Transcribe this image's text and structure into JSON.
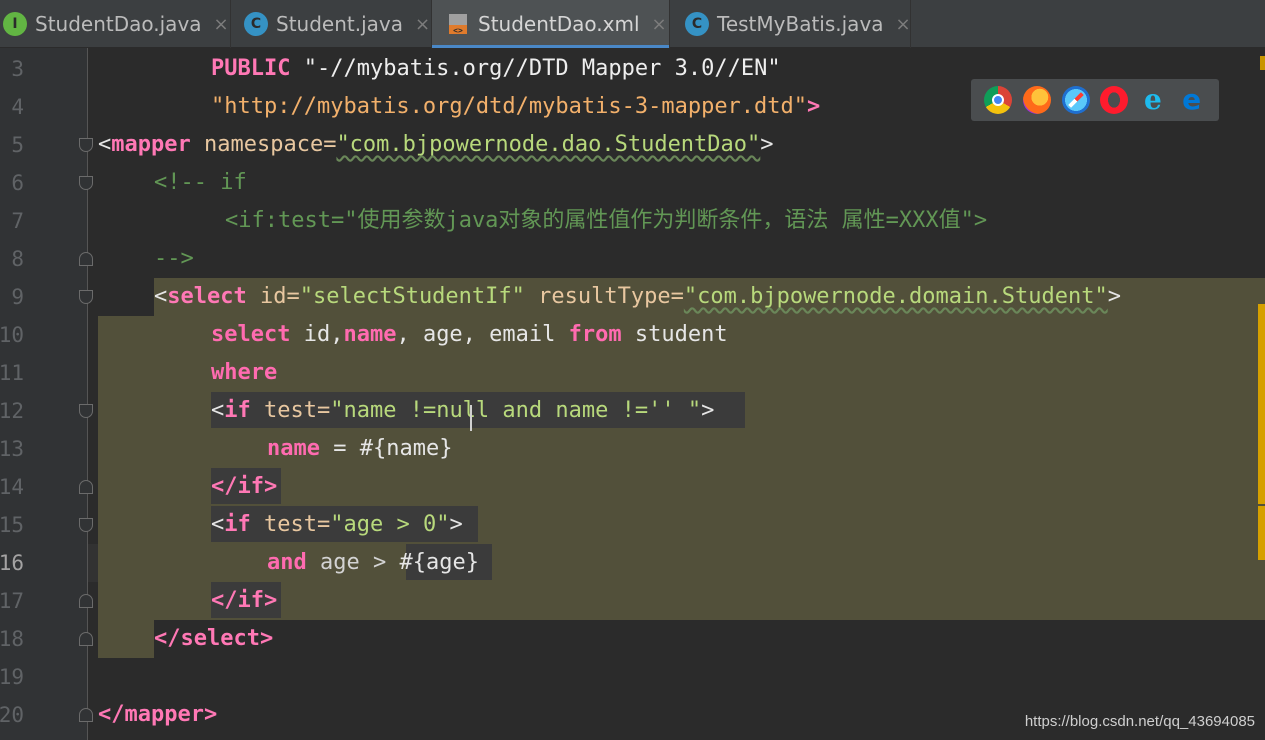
{
  "tabs": [
    {
      "icon": "interface-icon",
      "glyph": "I",
      "label": "StudentDao.java",
      "active": false
    },
    {
      "icon": "class-icon",
      "glyph": "C",
      "label": "Student.java",
      "active": false
    },
    {
      "icon": "xml-file-icon",
      "glyph": "",
      "label": "StudentDao.xml",
      "active": true
    },
    {
      "icon": "test-class-icon",
      "glyph": "C",
      "label": "TestMyBatis.java",
      "active": false
    }
  ],
  "tab_close_glyph": "×",
  "line_numbers": [
    "3",
    "4",
    "5",
    "6",
    "7",
    "8",
    "9",
    "10",
    "11",
    "12",
    "13",
    "14",
    "15",
    "16",
    "17",
    "18",
    "19",
    "20"
  ],
  "current_line": "16",
  "code": {
    "l3": {
      "kw": "PUBLIC",
      "str": "\"-//mybatis.org//DTD Mapper 3.0//EN\""
    },
    "l4": {
      "str": "\"http://mybatis.org/dtd/mybatis-3-mapper.dtd\"",
      "end": ">"
    },
    "l5": {
      "open": "<",
      "tag": "mapper",
      "attr": "namespace=",
      "val": "\"com.bjpowernode.dao.StudentDao\"",
      "end": ">"
    },
    "l6": {
      "comment": "<!-- if"
    },
    "l7": {
      "comment": "<if:test=\"使用参数java对象的属性值作为判断条件，语法 属性=XXX值\">"
    },
    "l8": {
      "comment": "-->"
    },
    "l9": {
      "open": "<",
      "tag": "select",
      "attr1": "id=",
      "val1": "\"selectStudentIf\"",
      "attr2": "resultType=",
      "val2": "\"com.bjpowernode.domain.Student\"",
      "end": ">"
    },
    "l10": {
      "kw1": "select",
      "t1": " id,",
      "kw2": "name",
      "t2": ", age, email ",
      "kw3": "from",
      "t3": " student"
    },
    "l11": {
      "kw": "where"
    },
    "l12": {
      "open": "<",
      "tag": "if",
      "attr": "test=",
      "val": "\"name !=null and name !='' \"",
      "end": ">"
    },
    "l13": {
      "kw": "name",
      "t": " = #{name}"
    },
    "l14": {
      "text": "</if>"
    },
    "l15": {
      "open": "<",
      "tag": "if",
      "attr": "test=",
      "val": "\"age > 0\"",
      "end": ">"
    },
    "l16": {
      "kw": "and",
      "t1": " age > ",
      "t2": "#{age}"
    },
    "l17": {
      "text": "</if>"
    },
    "l18": {
      "text": "</select>"
    },
    "l20": {
      "text": "</mapper>"
    }
  },
  "browser_icons": [
    "chrome-icon",
    "firefox-icon",
    "safari-icon",
    "opera-icon",
    "ie-icon",
    "edge-icon"
  ],
  "ie_glyph": "e",
  "edge_glyph": "e",
  "watermark": "https://blog.csdn.net/qq_43694085"
}
